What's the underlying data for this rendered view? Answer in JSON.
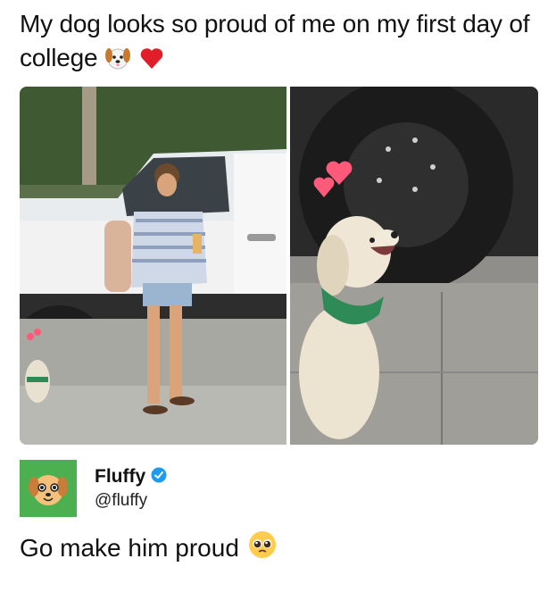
{
  "post": {
    "caption": "My dog looks so proud of me on my first day of college",
    "caption_emojis": [
      "dog-face-emoji",
      "red-heart-emoji"
    ]
  },
  "author": {
    "display_name": "Fluffy",
    "handle": "@fluffy",
    "verified": true,
    "avatar_color": "#4caf50",
    "verified_color": "#1d9bf0"
  },
  "reply": {
    "text": "Go make him proud",
    "emoji": "pleading-face-emoji"
  },
  "media": {
    "images": [
      "girl-standing-by-car-photo",
      "dog-looking-up-photo"
    ],
    "hearts_color": "#ff5a7a"
  }
}
